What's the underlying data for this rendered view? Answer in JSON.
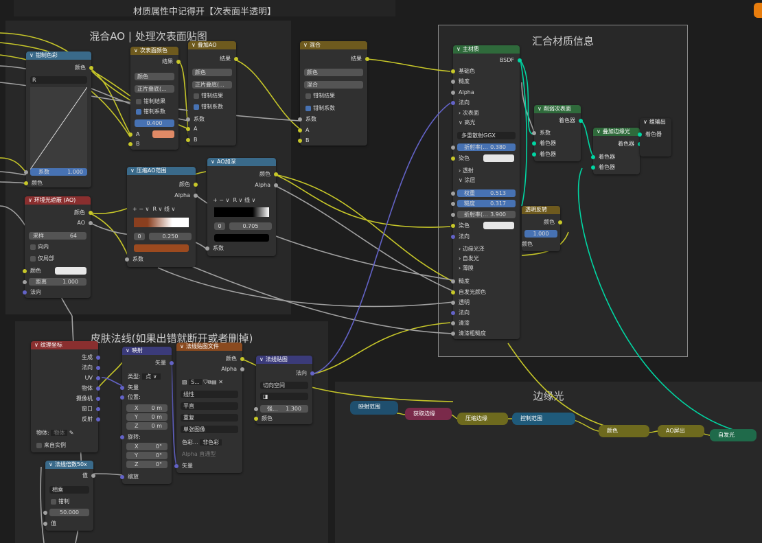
{
  "window_title": "材质属性中记得开【次表面半透明】",
  "frames": {
    "mix_ao": "混合AO | 处理次表面贴图",
    "combine": "汇合材质信息",
    "skin_normal": "皮肤法线(如果出错就断开或者删掉)",
    "rim_light": "边缘光"
  },
  "nodes": {
    "color_correct": {
      "title": "钳制色彩",
      "out_color": "颜色",
      "channel": "R",
      "factor_label": "系数",
      "factor_value": "1.000",
      "in_color": "颜色"
    },
    "sss_color": {
      "title": "次表面颜色",
      "out_result": "结果",
      "blend_mode": "颜色",
      "blend_type": "正片叠底(...",
      "clamp_result": "钳制结果",
      "clamp_factor": "钳制系数",
      "factor_value": "0.400",
      "in_a": "A",
      "in_b": "B"
    },
    "overlay_ao": {
      "title": "叠加AO",
      "out_result": "结果",
      "blend_mode": "颜色",
      "blend_type": "正片叠底(...",
      "clamp_result": "钳制结果",
      "clamp_factor": "钳制系数",
      "in_factor": "系数",
      "in_a": "A",
      "in_b": "B"
    },
    "mix": {
      "title": "混合",
      "out_result": "结果",
      "blend_mode": "颜色",
      "blend_type": "混合",
      "clamp_result": "钳制结果",
      "clamp_factor": "钳制系数",
      "in_factor": "系数",
      "in_a": "A",
      "in_b": "B"
    },
    "ao_range": {
      "title": "压缩AO范围",
      "out_color": "颜色",
      "out_alpha": "Alpha",
      "channel": "R",
      "interp": "线",
      "pos_index": "0",
      "pos_value": "0.250",
      "in_factor": "系数"
    },
    "ao_deepen": {
      "title": "AO加深",
      "out_color": "颜色",
      "out_alpha": "Alpha",
      "channel": "R",
      "interp": "线",
      "pos_index": "0",
      "pos_value": "0.705",
      "in_factor": "系数"
    },
    "ambient_occlusion": {
      "title": "环境光遮蔽 (AO)",
      "out_color": "颜色",
      "out_ao": "AO",
      "samples_label": "采样",
      "samples_value": "64",
      "inside": "向内",
      "only_local": "仅局部",
      "in_color": "颜色",
      "distance_label": "距离",
      "distance_value": "1.000",
      "in_normal": "法向"
    },
    "principled": {
      "title": "主材质",
      "out_bsdf": "BSDF",
      "in_base_color": "基础色",
      "in_roughness": "糙度",
      "in_alpha": "Alpha",
      "in_normal": "法向",
      "sub_surface": "次表面",
      "specular": "高光",
      "distribution": "多重散射GGX",
      "ior_label": "折射率(...",
      "ior_value": "0.380",
      "tint": "染色",
      "transmission": "透射",
      "coat": "涂层",
      "coat_weight_label": "权重",
      "coat_weight_value": "0.513",
      "coat_rough_label": "糙度",
      "coat_rough_value": "0.317",
      "coat_ior_label": "折射率(...",
      "coat_ior_value": "3.900",
      "coat_tint": "染色",
      "coat_normal": "法向",
      "sheen": "边缘光泽",
      "emission": "自发光",
      "thin_film": "薄膜",
      "in_roughness2": "糙度",
      "in_emission_color": "自发光颜色",
      "in_transmission": "透明",
      "in_normal2": "法向",
      "in_clearcoat": "清漆",
      "in_clearcoat_rough": "清漆粗糙度"
    },
    "remove_sss": {
      "title": "削弱次表面",
      "out_shader": "着色器",
      "in_factor": "系数",
      "in_shader1": "着色器",
      "in_shader2": "着色器"
    },
    "add_rim": {
      "title": "叠加边缘光",
      "out_shader": "着色器",
      "in_shader1": "着色器",
      "in_shader2": "着色器"
    },
    "output": {
      "title": "组输出",
      "in_shader": "着色器"
    },
    "transparent_invert": {
      "title": "透明反转",
      "out_color": "颜色",
      "value": "1.000",
      "in_color": "颜色"
    },
    "tex_coord": {
      "title": "纹理坐标",
      "outputs": [
        "生成",
        "法向",
        "UV",
        "物体",
        "摄像机",
        "窗口",
        "反射"
      ],
      "object_label": "物体:",
      "object_placeholder": "物体",
      "from_instancer": "来自实例"
    },
    "mapping": {
      "title": "映射",
      "out_vector": "矢量",
      "type_label": "类型:",
      "type_value": "点",
      "in_vector": "矢量",
      "location": "位置:",
      "rotation": "旋转:",
      "scale": "缩放",
      "loc": [
        [
          "X",
          "0 m"
        ],
        [
          "Y",
          "0 m"
        ],
        [
          "Z",
          "0 m"
        ]
      ],
      "rot": [
        [
          "X",
          "0°"
        ],
        [
          "Y",
          "0°"
        ],
        [
          "Z",
          "0°"
        ]
      ]
    },
    "normal_tex": {
      "title": "法线贴图文件",
      "out_color": "颜色",
      "out_alpha": "Alpha",
      "image_name": "S...",
      "interp": "线性",
      "projection": "平直",
      "extension": "重复",
      "source": "单张图像",
      "colorspace_label": "色彩...",
      "colorspace_value": "非色彩",
      "alpha_label": "Alpha",
      "alpha_value": "直通型",
      "in_vector": "矢量"
    },
    "normal_map": {
      "title": "法线贴图",
      "out_normal": "法向",
      "space": "切向空间",
      "strength_label": "强...",
      "strength_value": "1.300",
      "in_color": "颜色"
    },
    "normal_mult": {
      "title": "法线倍数50x",
      "out_value": "值",
      "op": "相乘",
      "clamp": "钳制",
      "value": "50.000",
      "in_value": "值"
    }
  },
  "rim_groups": [
    "映射范围",
    "获取边缘",
    "压缩边缘",
    "控制范围",
    "颜色",
    "AO屏出",
    "自发光"
  ],
  "colors": {
    "background": "#1d1d1d",
    "frame": "#282828",
    "node": "#303030",
    "hdr_converter": "#3a6a8a",
    "hdr_color": "#6e5a1e",
    "hdr_input": "#8a2f2f",
    "hdr_shader": "#2f6a3b",
    "hdr_vector": "#3b3b7a",
    "hdr_group": "#1f5a3a",
    "hdr_texture": "#8a4a1f",
    "socket_color": "#c7c729",
    "socket_gray": "#a1a1a1",
    "socket_vector": "#6363c7",
    "socket_shader": "#00d6a3",
    "accent_blue": "#4772b3"
  }
}
